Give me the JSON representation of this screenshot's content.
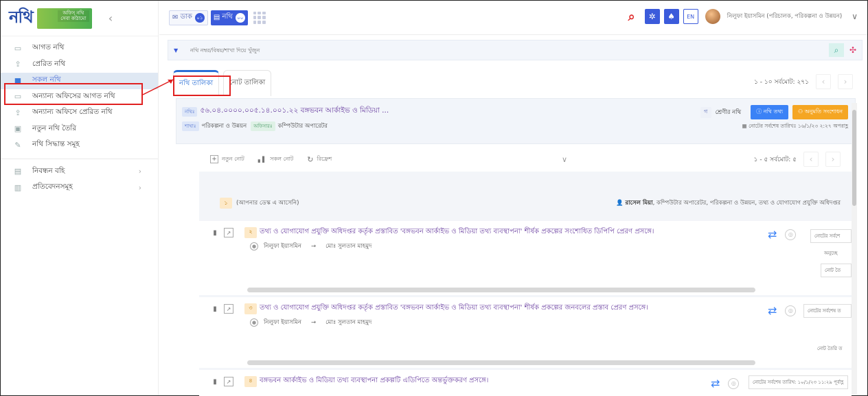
{
  "logo": {
    "text": "নথি",
    "badge": "অফিস্ নথি\nসেবা কাঠামো"
  },
  "sidebar": {
    "items": [
      {
        "label": "আগত নথি",
        "icon": "inbox-icon"
      },
      {
        "label": "প্রেরিত নথি",
        "icon": "outbox-icon"
      },
      {
        "label": "সকল নথি",
        "icon": "all-files-icon",
        "active": true
      },
      {
        "label": "অন্যান্য অফিসের আগত নথি",
        "icon": "inbox-icon"
      },
      {
        "label": "অন্যান্য অফিসে প্রেরিত নথি",
        "icon": "outbox-icon"
      },
      {
        "label": "নতুন নথি তৈরি",
        "icon": "new-file-icon"
      },
      {
        "label": "নথি সিদ্ধান্ত সমূহ",
        "icon": "pin-icon"
      }
    ],
    "sections": [
      {
        "label": "নিবন্ধন বহি",
        "icon": "register-icon"
      },
      {
        "label": "প্রতিবেদনসমূহ",
        "icon": "report-icon"
      }
    ]
  },
  "topbar": {
    "dak_label": "ডাক",
    "dak_count": "০১",
    "nothi_label": "নথি",
    "nothi_count": "০০",
    "lang": "EN",
    "user": "নিলুফা ইয়াসমিন (পরিচালক, পরিকল্পনা ও উন্নয়ন)",
    "accent": "#3b5bdb"
  },
  "search": {
    "placeholder": "নথি নম্বর/বিষয়/শাখা দিয়ে খুঁজুন"
  },
  "tabs": {
    "file_list": "নথি তালিকা",
    "note_list": "নোট তালিকা"
  },
  "pager_top": "১ - ১০ সর্বমোট: ২৭১",
  "file": {
    "tag": "নথিঃ",
    "number_title": "৫৬.০৪.০০০০.০০৫.১৪.০০১.২২ বঙ্গভবন আর্কাইভ ও মিডিয়া ...",
    "branch_tag": "শাখাঃ",
    "branch": "পরিকল্পনা ও উন্নয়ন",
    "officer_tag": "অফিসারঃ",
    "officer": "কম্পিউটার অপারেটর",
    "class_badge": "গ",
    "class_label": "শ্রেণীর নথি",
    "info_btn": "নথি তথ্য",
    "permission_btn": "অনুমতি সংশোধন",
    "last_date": "নোটের সর্বশেষ তারিখঃ ১৬/১/২৩ ২:২৭ অপরাহ্ণ"
  },
  "toolbar": {
    "new_note": "নতুন নোট",
    "all_notes": "সকল নোট",
    "refresh": "রিফ্রেশ",
    "pager": "১ - ৫ সর্বমোট: ৫"
  },
  "owner": {
    "num": "১",
    "desk_text": "(আপনার ডেস্ক এ আসেনি)",
    "name": "রাসেল মিয়া",
    "designation": ", কম্পিউটার অপারেটর, পরিকল্পনা ও উন্নয়ন, তথ্য ও যোগাযোগ প্রযুক্তি অধিদপ্তর"
  },
  "notes": [
    {
      "num": "২",
      "title": "তথ্য ও যোগাযোগ প্রযুক্তি অধিদপ্তর কর্তৃক প্রস্তাবিত 'বঙ্গভবন আর্কাইভ ও মিডিয়া তথ্য ব্যবস্থাপনা' শীর্ষক প্রকল্পের সংশোধিত ডিপিপি প্রেরণ প্রসঙ্গে।",
      "from": "নিলুফা ইয়াসমিন",
      "to": "মোঃ সুলতান মাহমুদ",
      "side1": "নোটের সর্বশে",
      "side2": "অনুচ্ছে",
      "side3": "নোট তৈ"
    },
    {
      "num": "৩",
      "title": "তথ্য ও যোগাযোগ প্রযুক্তি অধিদপ্তর কর্তৃক প্রস্তাবিত 'বঙ্গভবন আর্কাইভ ও মিডিয়া তথ্য ব্যবস্থাপনা' শীর্ষক প্রকল্পের জনবলের প্রস্তাব প্রেরণ প্রসঙ্গে।",
      "from": "নিলুফা ইয়াসমিন",
      "to": "মোঃ সুলতান মাহমুদ",
      "side1": "নোটের সর্বশেষ ত",
      "side3": "নোট তৈরি ত"
    },
    {
      "num": "৪",
      "title": "বঙ্গভবন আর্কাইভ ও মিডিয়া তথ্য ব্যবস্থাপনা প্রকল্পটি এডিপিতে অন্তর্ভুক্তকরণ প্রসঙ্গে।",
      "side1": "নোটের সর্বশেষ তারিখ: ১০/১/২৩ ১১:২৯ পূর্বাহ্ণ"
    }
  ]
}
